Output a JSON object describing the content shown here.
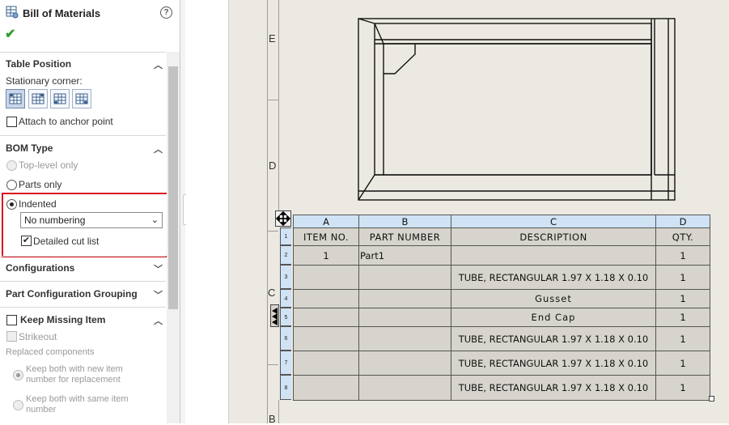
{
  "panel": {
    "title": "Bill of Materials",
    "icons": {
      "bom": "bom-table-icon",
      "help": "help-icon",
      "ok": "checkmark-icon"
    },
    "help_glyph": "?",
    "ok_glyph": "✔",
    "table_position": {
      "header": "Table Position",
      "stationary_label": "Stationary corner:",
      "corners": [
        "top-left-corner-icon",
        "top-right-corner-icon",
        "bottom-left-corner-icon",
        "bottom-right-corner-icon"
      ],
      "attach_label": "Attach to anchor point"
    },
    "bom_type": {
      "header": "BOM Type",
      "options": [
        "Top-level only",
        "Parts only",
        "Indented"
      ],
      "selected": "Indented",
      "numbering": "No numbering",
      "detailed_cut_list": "Detailed cut list"
    },
    "configurations": "Configurations",
    "part_config_grouping": "Part Configuration Grouping",
    "keep_missing": {
      "header": "Keep Missing Item",
      "strikeout": "Strikeout",
      "replaced_components": "Replaced components",
      "option1_line1": "Keep both with new item",
      "option1_line2": "number for replacement",
      "option2_line1": "Keep both with same item",
      "option2_line2": "number"
    },
    "chevron_up": "︿",
    "chevron_down": "﹀",
    "dropdown_arrow": "⌄"
  },
  "sheet": {
    "zones": [
      "E",
      "D",
      "C",
      "B"
    ]
  },
  "bom_table": {
    "column_letters": [
      "A",
      "B",
      "C",
      "D"
    ],
    "headers": [
      "ITEM NO.",
      "PART NUMBER",
      "DESCRIPTION",
      "QTY."
    ],
    "rows": [
      {
        "item": "1",
        "part": "Part1",
        "desc": "",
        "qty": "1"
      },
      {
        "item": "",
        "part": "",
        "desc": "TUBE, RECTANGULAR 1.97 X 1.18 X 0.10",
        "qty": "1"
      },
      {
        "item": "",
        "part": "",
        "desc": "Gusset",
        "qty": "1"
      },
      {
        "item": "",
        "part": "",
        "desc": "End Cap",
        "qty": "1"
      },
      {
        "item": "",
        "part": "",
        "desc": "TUBE, RECTANGULAR 1.97 X 1.18 X 0.10",
        "qty": "1"
      },
      {
        "item": "",
        "part": "",
        "desc": "TUBE, RECTANGULAR 1.97 X 1.18 X 0.10",
        "qty": "1"
      },
      {
        "item": "",
        "part": "",
        "desc": "TUBE, RECTANGULAR 1.97 X 1.18 X 0.10",
        "qty": "1"
      }
    ],
    "row_numbers": [
      "1",
      "2",
      "3",
      "4",
      "5",
      "6",
      "7",
      "8"
    ]
  }
}
